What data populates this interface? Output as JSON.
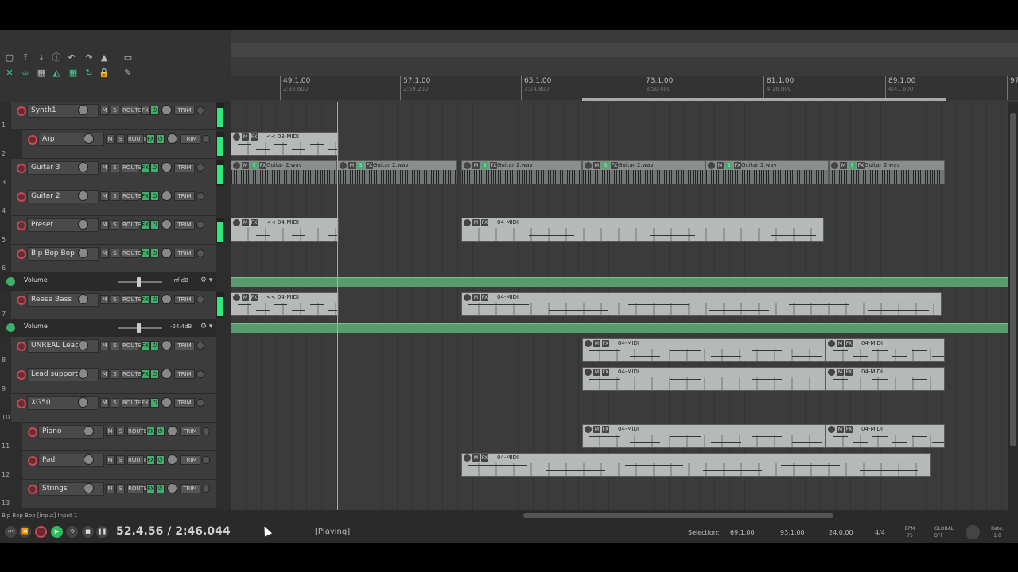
{
  "toolbar": {
    "row1_icons": [
      "new-file-icon",
      "save-icon",
      "download-icon",
      "info-icon",
      "undo-icon",
      "redo-icon",
      "metronome-icon"
    ],
    "row2_icons": [
      "ripple-icon",
      "link-icon",
      "grid-icon",
      "snap-icon",
      "marker-icon",
      "loop-icon",
      "lock-icon"
    ]
  },
  "ruler": {
    "marks": [
      {
        "bar": "49.1.00",
        "time": "2:33.600"
      },
      {
        "bar": "57.1.00",
        "time": "2:59.200"
      },
      {
        "bar": "65.1.00",
        "time": "3:24.800"
      },
      {
        "bar": "73.1.00",
        "time": "3:50.400"
      },
      {
        "bar": "81.1.00",
        "time": "4:16.000"
      },
      {
        "bar": "89.1.00",
        "time": "4:41.600"
      },
      {
        "bar": "97",
        "time": ""
      }
    ]
  },
  "tracks": [
    {
      "num": "1",
      "name": "Synth1"
    },
    {
      "num": "2",
      "name": "Arp"
    },
    {
      "num": "3",
      "name": "Guitar 3"
    },
    {
      "num": "4",
      "name": "Guitar 2"
    },
    {
      "num": "5",
      "name": "Preset"
    },
    {
      "num": "6",
      "name": "Bip Bop Bop"
    },
    {
      "num": "7",
      "name": "Reese Bass"
    },
    {
      "num": "8",
      "name": "UNREAL Lead"
    },
    {
      "num": "9",
      "name": "Lead support"
    },
    {
      "num": "10",
      "name": "XG50"
    },
    {
      "num": "11",
      "name": "Piano"
    },
    {
      "num": "12",
      "name": "Pad"
    },
    {
      "num": "13",
      "name": "Strings"
    }
  ],
  "envelopes": [
    {
      "name": "Volume",
      "value": "-inf dB"
    },
    {
      "name": "Volume",
      "value": "-24.4dB"
    }
  ],
  "track_buttons": {
    "mute": "M",
    "solo": "S",
    "route": "ROUTE",
    "fx": "FX",
    "trim": "TRIM"
  },
  "items": {
    "midi03": "<< 03-MIDI",
    "midi04a": "<< 04-MIDI",
    "midi04": "04-MIDI",
    "guitar": "Guitar 2.wav",
    "btn_m": "M",
    "btn_fx": "FX",
    "btn_s": "S"
  },
  "statusline": "Bip Bop Bop [input] Input 1",
  "transport": {
    "position": "52.4.56 / 2:46.044",
    "state": "[Playing]",
    "selection_label": "Selection:",
    "sel_start": "69.1.00",
    "sel_end": "93.1.00",
    "sel_len": "24.0.00",
    "time_sig": "4/4",
    "bpm_label": "BPM",
    "bpm": "75",
    "global_label": "GLOBAL",
    "global_state": "OFF",
    "rate_label": "Rate:",
    "rate": "1.0"
  },
  "colors": {
    "accent": "#3fae6b",
    "meter": "#2fe87a",
    "record": "#c44b5a",
    "playcursor": "#c8a96a",
    "envelope": "#5a9b6e"
  }
}
